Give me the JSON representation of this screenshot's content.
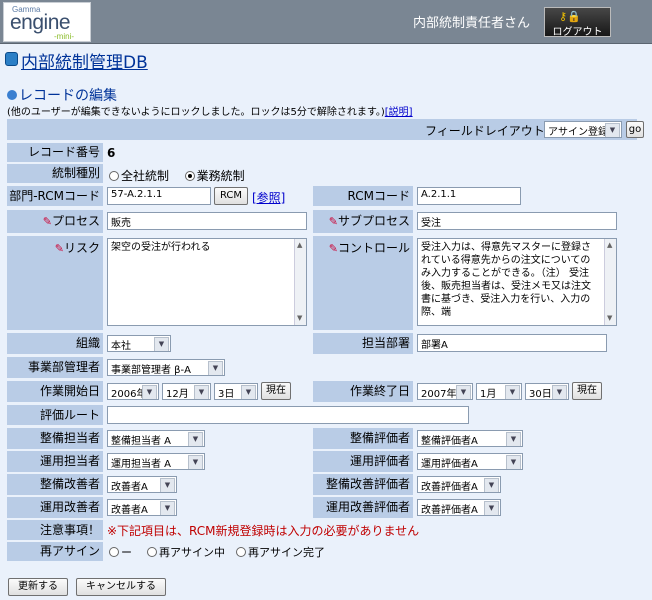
{
  "header": {
    "logo_top": "Gamma",
    "logo_main": "engine",
    "logo_sub": "-mini-",
    "user": "内部統制責任者さん",
    "logout": "ログアウト"
  },
  "db_title": "内部統制管理DB",
  "section": {
    "title": "レコードの編集",
    "note": "(他のユーザーが編集できないようにロックしました。ロックは5分で解除されます。)",
    "help_link": "[説明]"
  },
  "layout": {
    "label": "フィールドレイアウト",
    "selected": "アサイン登録",
    "go": "go"
  },
  "fields": {
    "record_no": {
      "label": "レコード番号",
      "value": "6"
    },
    "control_type": {
      "label": "統制種別",
      "options": [
        "全社統制",
        "業務統制"
      ],
      "selected": "業務統制"
    },
    "dept_rcm": {
      "label": "部門-RCMコード",
      "value": "57-A.2.1.1",
      "rcm_button": "RCM",
      "ref_link": "[参照]"
    },
    "rcm_code": {
      "label": "RCMコード",
      "value": "A.2.1.1"
    },
    "process": {
      "label": "プロセス",
      "value": "販売"
    },
    "subprocess": {
      "label": "サブプロセス",
      "value": "受注"
    },
    "risk": {
      "label": "リスク",
      "value": "架空の受注が行われる"
    },
    "control": {
      "label": "コントロール",
      "value": "受注入力は、得意先マスターに登録されている得意先からの注文についてのみ入力することができる。（注） 受注後、販売担当者は、受注メモ又は注文書に基づき、受注入力を行い、入力の際、端"
    },
    "org": {
      "label": "組織",
      "value": "本社"
    },
    "dept": {
      "label": "担当部署",
      "value": "部署A"
    },
    "biz_manager": {
      "label": "事業部管理者",
      "value": "事業部管理者 β-A"
    },
    "start_date": {
      "label": "作業開始日",
      "year": "2006年",
      "month": "12月",
      "day": "3日",
      "now": "現在"
    },
    "end_date": {
      "label": "作業終了日",
      "year": "2007年",
      "month": "1月",
      "day": "30日",
      "now": "現在"
    },
    "eval_route": {
      "label": "評価ルート",
      "value": ""
    },
    "setup_owner": {
      "label": "整備担当者",
      "value": "整備担当者 A"
    },
    "setup_eval": {
      "label": "整備評価者",
      "value": "整備評価者A"
    },
    "op_owner": {
      "label": "運用担当者",
      "value": "運用担当者 A"
    },
    "op_eval": {
      "label": "運用評価者",
      "value": "運用評価者A"
    },
    "setup_improver": {
      "label": "整備改善者",
      "value": "改善者A"
    },
    "setup_imp_eval": {
      "label": "整備改善評価者",
      "value": "改善評価者A"
    },
    "op_improver": {
      "label": "運用改善者",
      "value": "改善者A"
    },
    "op_imp_eval": {
      "label": "運用改善評価者",
      "value": "改善評価者A"
    },
    "caution": {
      "label": "注意事項！",
      "value": "※下記項目は、RCM新規登録時は入力の必要がありません"
    },
    "reassign": {
      "label": "再アサイン",
      "options": [
        "ー",
        "再アサイン中",
        "再アサイン完了"
      ]
    }
  },
  "buttons": {
    "update": "更新する",
    "cancel": "キャンセルする"
  }
}
